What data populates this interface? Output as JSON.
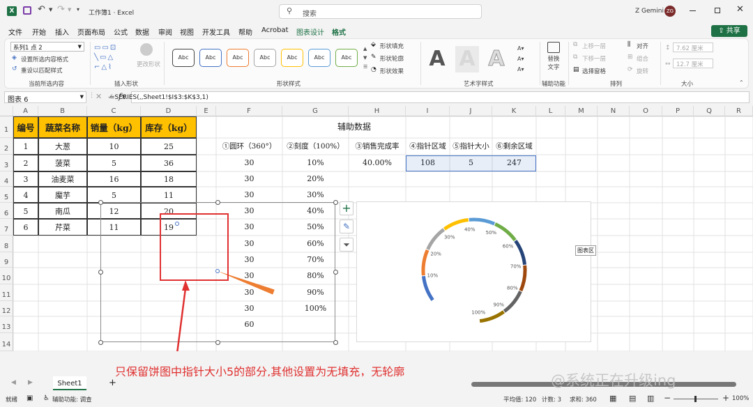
{
  "titlebar": {
    "autosave_icon": "excel-logo",
    "save_icon": "save-icon",
    "undo_icon": "undo-icon",
    "redo_icon": "redo-icon",
    "doc_title": "工作簿1 · Excel",
    "search_placeholder": "搜索",
    "user_name": "Z Gemini",
    "user_initials": "ZG"
  },
  "menu": {
    "items": [
      "文件",
      "开始",
      "插入",
      "页面布局",
      "公式",
      "数据",
      "审阅",
      "视图",
      "开发工具",
      "帮助",
      "Acrobat",
      "图表设计",
      "格式"
    ],
    "active": "格式",
    "share_label": "共享"
  },
  "ribbon": {
    "current_selection": {
      "dropdown_value": "系列1 点 2",
      "set_format": "设置所选内容格式",
      "reset_style": "重设以匹配样式",
      "group": "当前所选内容"
    },
    "insert_shapes": {
      "change_shape": "更改形状",
      "group": "插入形状"
    },
    "shape_styles": {
      "tiles": [
        "Abc",
        "Abc",
        "Abc",
        "Abc",
        "Abc",
        "Abc",
        "Abc"
      ],
      "tile_colors": [
        "#444444",
        "#4472c4",
        "#ed7d31",
        "#a5a5a5",
        "#ffc000",
        "#5b9bd5",
        "#70ad47"
      ],
      "fill": "形状填充",
      "outline": "形状轮廓",
      "effect": "形状效果",
      "group": "形状样式"
    },
    "wordart": {
      "letters": [
        "A",
        "A",
        "A"
      ],
      "group": "艺术字样式"
    },
    "accessibility": {
      "alt_text_1": "替换",
      "alt_text_2": "文字",
      "group": "辅助功能"
    },
    "arrange": {
      "bring_forward": "上移一层",
      "send_backward": "下移一层",
      "selection_pane": "选择窗格",
      "align": "对齐",
      "group_btn": "组合",
      "rotate": "旋转",
      "group": "排列"
    },
    "size": {
      "height": "7.62 厘米",
      "width": "12.7 厘米",
      "group": "大小"
    }
  },
  "formula": {
    "name_box": "图表 6",
    "fx": "fx",
    "formula": "=SERIES(,,Sheet1!$I$3:$K$3,1)"
  },
  "columns": [
    "A",
    "B",
    "C",
    "D",
    "E",
    "F",
    "G",
    "H",
    "I",
    "J",
    "K",
    "L",
    "M",
    "N",
    "O",
    "P",
    "Q",
    "R"
  ],
  "rows": [
    "1",
    "2",
    "3",
    "4",
    "5",
    "6",
    "7",
    "8",
    "9",
    "10",
    "11",
    "12",
    "13",
    "14"
  ],
  "table": {
    "headers": [
      "编号",
      "蔬菜名称",
      "销量（kg）",
      "库存（kg）"
    ],
    "rows": [
      [
        "1",
        "大葱",
        "10",
        "25"
      ],
      [
        "2",
        "菠菜",
        "5",
        "36"
      ],
      [
        "3",
        "油麦菜",
        "16",
        "18"
      ],
      [
        "4",
        "魔芋",
        "5",
        "11"
      ],
      [
        "5",
        "南瓜",
        "12",
        "20"
      ],
      [
        "6",
        "芹菜",
        "11",
        "19"
      ]
    ]
  },
  "aux": {
    "title": "辅助数据",
    "headers": [
      "①圆环（360°）",
      "②刻度（100%）",
      "③销售完成率",
      "④指针区域",
      "⑤指针大小",
      "⑥剩余区域"
    ],
    "ring": [
      "30",
      "30",
      "30",
      "30",
      "30",
      "30",
      "30",
      "30",
      "30",
      "30",
      "60"
    ],
    "scale": [
      "10%",
      "20%",
      "30%",
      "40%",
      "50%",
      "60%",
      "70%",
      "80%",
      "90%",
      "100%"
    ],
    "rate": "40.00%",
    "pointer_area": "108",
    "pointer_size": "5",
    "remaining": "247"
  },
  "chart_data": [
    {
      "type": "pie",
      "categories": [
        "④指针区域",
        "⑤指针大小",
        "⑥剩余区域"
      ],
      "values": [
        108,
        5,
        247
      ],
      "visible": [
        false,
        true,
        false
      ],
      "colors": [
        "none",
        "#ed7d31",
        "none"
      ]
    },
    {
      "type": "pie",
      "title": "",
      "categories": [
        "10%",
        "20%",
        "30%",
        "40%",
        "50%",
        "60%",
        "70%",
        "80%",
        "90%",
        "100%",
        ""
      ],
      "values": [
        30,
        30,
        30,
        30,
        30,
        30,
        30,
        30,
        30,
        30,
        60
      ],
      "colors": [
        "#4472c4",
        "#ed7d31",
        "#a5a5a5",
        "#ffc000",
        "#5b9bd5",
        "#70ad47",
        "#264478",
        "#9e480e",
        "#636363",
        "#997300",
        "none"
      ],
      "chart_area_tooltip": "图表区"
    }
  ],
  "annotation": {
    "text": "只保留饼图中指针大小5的部分,其他设置为无填充，无轮廓",
    "color": "#e03030"
  },
  "sheet": {
    "tab": "Sheet1",
    "add": "+"
  },
  "status": {
    "ready": "就绪",
    "accessibility": "辅助功能: 调查",
    "average": "平均值: 120",
    "count": "计数: 3",
    "sum": "求和: 360",
    "zoom": "100%"
  },
  "watermark": "@系统正在升级ing"
}
